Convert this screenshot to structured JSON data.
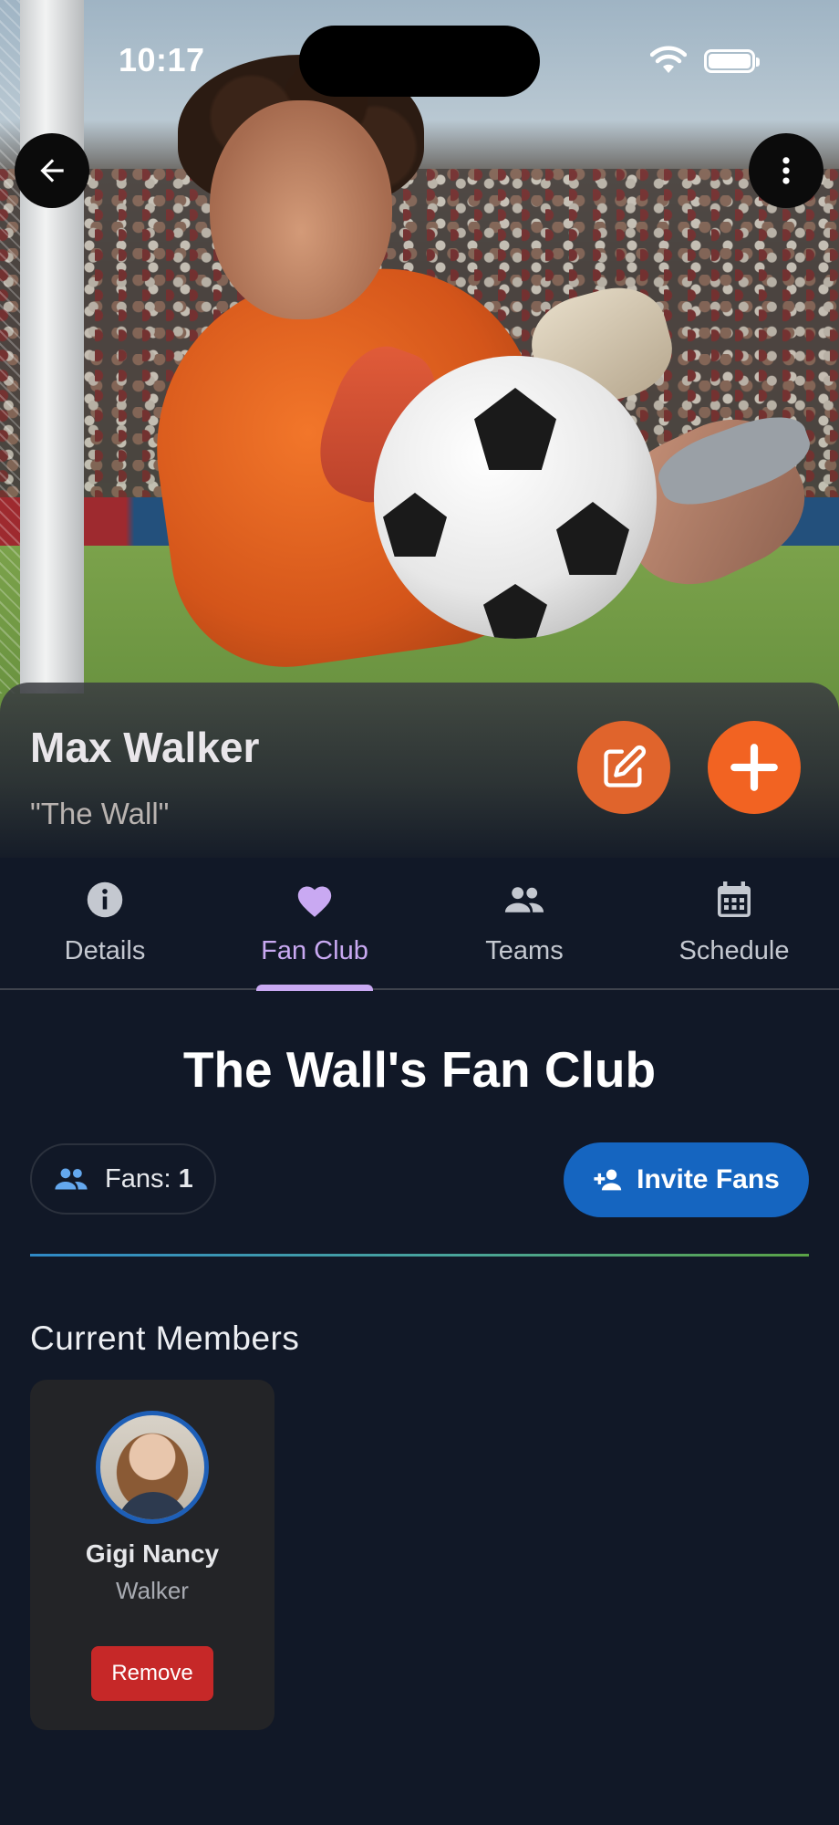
{
  "status_bar": {
    "time": "10:17"
  },
  "header": {
    "player_name": "Max Walker",
    "nickname": "\"The Wall\""
  },
  "tabs": [
    {
      "label": "Details",
      "icon": "info-icon"
    },
    {
      "label": "Fan Club",
      "icon": "heart-icon",
      "active": true
    },
    {
      "label": "Teams",
      "icon": "people-icon"
    },
    {
      "label": "Schedule",
      "icon": "calendar-icon"
    }
  ],
  "fan_club": {
    "title": "The Wall's Fan Club",
    "fans_label": "Fans:",
    "fans_count": "1",
    "invite_label": "Invite Fans",
    "members_heading": "Current Members",
    "members": [
      {
        "first_name": "Gigi Nancy",
        "last_name": "Walker",
        "remove_label": "Remove"
      }
    ]
  },
  "colors": {
    "background": "#111827",
    "accent_orange": "#f26322",
    "active_tab": "#c9a9f2",
    "invite_blue": "#1565c0",
    "remove_red": "#c62828"
  }
}
